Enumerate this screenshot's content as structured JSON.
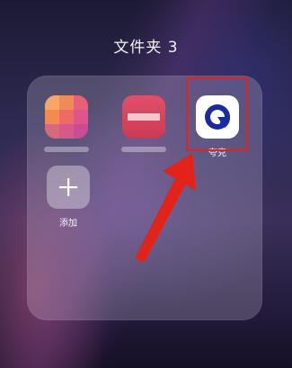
{
  "folder": {
    "title": "文件夹 3"
  },
  "apps": [
    {
      "label": "",
      "blurred": true
    },
    {
      "label": "",
      "blurred": true
    },
    {
      "label": "夸克",
      "blurred": false
    },
    {
      "label": "添加",
      "blurred": false
    }
  ],
  "colors": {
    "highlight": "#e2231a",
    "quark_ring": "#1a2aa0"
  },
  "icons": {
    "quark": "quark-logo-icon",
    "add": "plus-icon"
  }
}
